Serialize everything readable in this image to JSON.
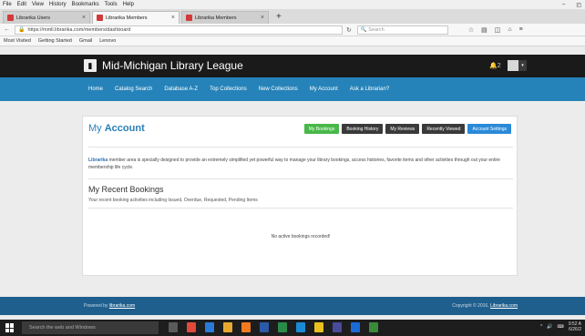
{
  "browser": {
    "menu": [
      "File",
      "Edit",
      "View",
      "History",
      "Bookmarks",
      "Tools",
      "Help"
    ],
    "window_controls": [
      "–",
      "◰"
    ],
    "tabs": [
      {
        "label": "Librarika Users",
        "active": false
      },
      {
        "label": "Librarika Members",
        "active": true
      },
      {
        "label": "Librarika Members",
        "active": false
      }
    ],
    "newtab": "+",
    "url": "https://mmll.librarika.com/members/dashboard",
    "search_placeholder": "Search",
    "bookmarks": [
      "Most Visited",
      "Getting Started",
      "Gmail",
      "Lenovo"
    ]
  },
  "site": {
    "title": "Mid-Michigan Library League",
    "notif": "2",
    "nav": [
      "Home",
      "Catalog Search",
      "Database A-Z",
      "Top Collections",
      "New Collections",
      "My Account",
      "Ask a Librarian?"
    ]
  },
  "account": {
    "title_prefix": "My ",
    "title_bold": "Account",
    "buttons": [
      "My Bookings",
      "Booking History",
      "My Reviews",
      "Recently Viewed",
      "Account Settings"
    ],
    "brand": "Librarika",
    "description": "member area is specially designed to provide an extremely simplified yet powerful way to manage your library bookings, access histories, favorite items and other activities through out your entire membership life cycle.",
    "bookings_title": "My Recent Bookings",
    "bookings_sub": "Your recent booking activities including Issued, Overdue, Requested, Pending Items",
    "empty": "No active bookings recorded!"
  },
  "footer": {
    "powered_prefix": "Powered by ",
    "powered_link": "librarika.com",
    "copyright_prefix": "Copyright © 2016, ",
    "copyright_link": "Librarika.com"
  },
  "taskbar": {
    "search": "Search the web and Windows",
    "time": "9:52 A",
    "date": "6/26/2"
  },
  "colors": {
    "header_bg": "#1a1a1a",
    "nav_bg": "#2683b9",
    "footer_bg": "#1f5f8e",
    "green_btn": "#48b848",
    "blue_btn": "#2a8ad8"
  }
}
